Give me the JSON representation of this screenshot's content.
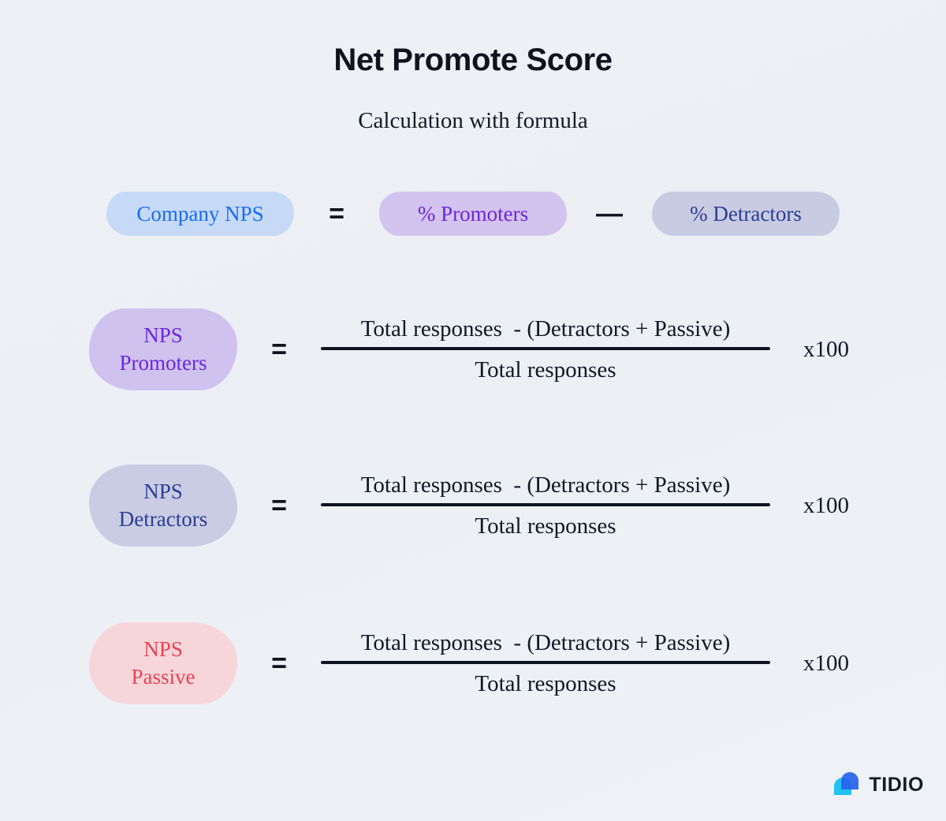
{
  "header": {
    "title": "Net Promote Score",
    "subtitle": "Calculation with formula"
  },
  "top_equation": {
    "left_label": "Company NPS",
    "equals": "=",
    "first_term": "% Promoters",
    "minus": "—",
    "second_term": "% Detractors"
  },
  "formulas": [
    {
      "label_line1": "NPS",
      "label_line2": "Promoters",
      "equals": "=",
      "numerator": "Total responses  - (Detractors + Passive)",
      "denominator": "Total responses",
      "multiplier": "x100"
    },
    {
      "label_line1": "NPS",
      "label_line2": "Detractors",
      "equals": "=",
      "numerator": "Total responses  - (Detractors + Passive)",
      "denominator": "Total responses",
      "multiplier": "x100"
    },
    {
      "label_line1": "NPS",
      "label_line2": "Passive",
      "equals": "=",
      "numerator": "Total responses  - (Detractors + Passive)",
      "denominator": "Total responses",
      "multiplier": "x100"
    }
  ],
  "logo": {
    "text": "TIDIO",
    "mark_color_dark": "#2563eb",
    "mark_color_light": "#22c2f5"
  },
  "colors": {
    "background": "#eef0f5",
    "ink": "#10131c",
    "blue": "#1a6bf5",
    "purple": "#6c26d9",
    "navy": "#2c3e94",
    "red": "#e94256",
    "pill_blue_bg": "#c6daf7",
    "pill_purple_bg": "#d3c3ef",
    "pill_gray_bg": "#c8cbe2",
    "pill_pink_bg": "#f7d6d9"
  }
}
